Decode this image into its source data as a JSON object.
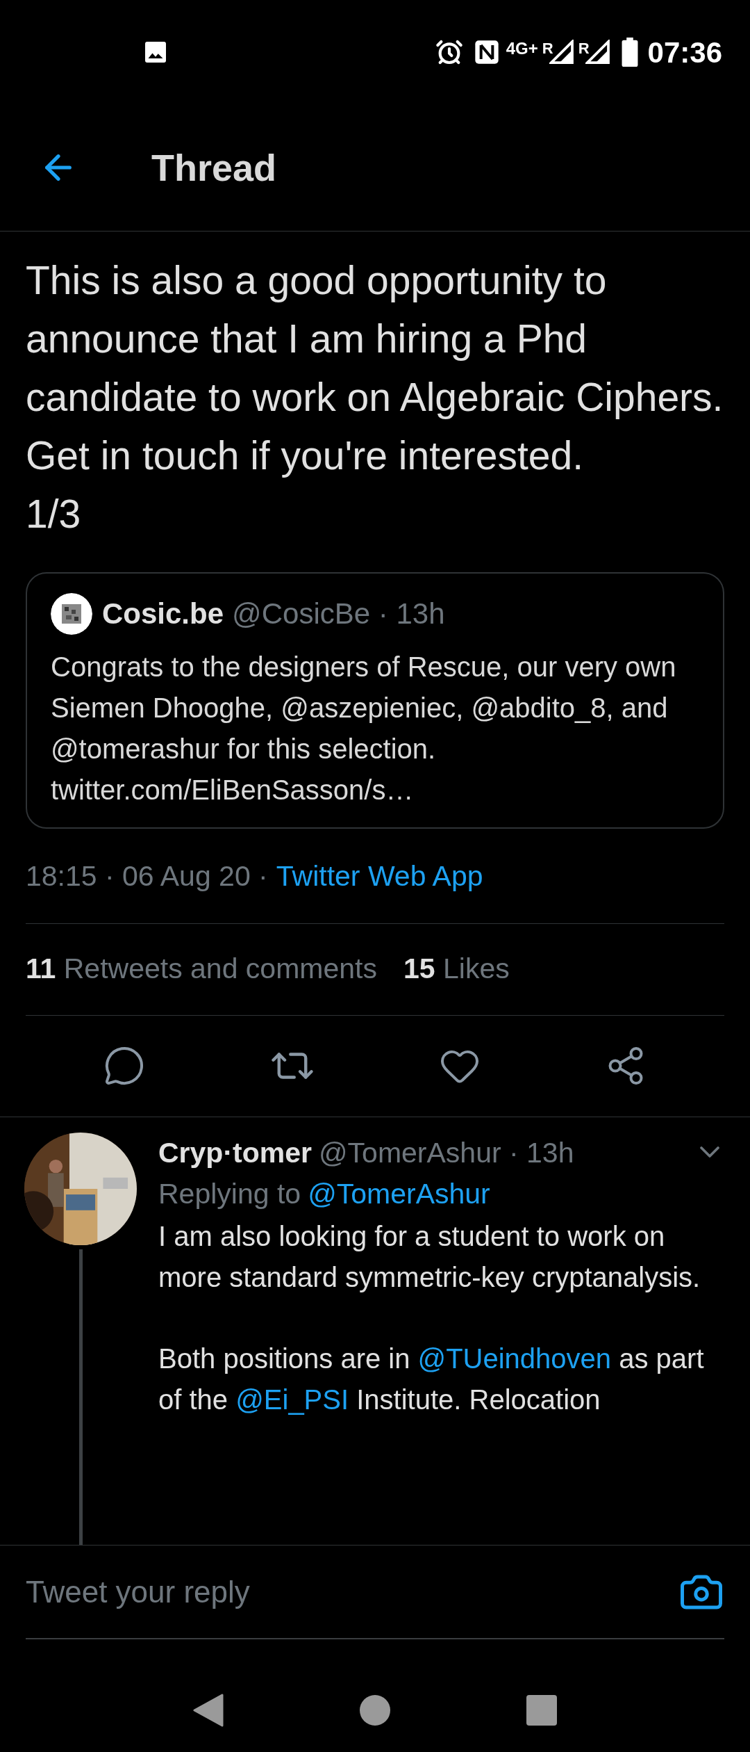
{
  "status_bar": {
    "network": "4G+",
    "roaming": [
      "R",
      "R"
    ],
    "time": "07:36"
  },
  "header": {
    "title": "Thread"
  },
  "tweet": {
    "text": "This is also a good opportunity to announce that I am hiring a Phd candidate to work on Algebraic Ciphers. Get in touch if you're interested.\n1/3",
    "quote": {
      "name": "Cosic.be",
      "meta": "@CosicBe · 13h",
      "text": "Congrats to the designers of Rescue, our very own Siemen Dhooghe, @aszepieniec, @abdito_8, and @tomerashur for this selection. twitter.com/EliBenSasson/s…"
    },
    "timestamp": "18:15 · 06 Aug 20 ·",
    "source": "Twitter Web App",
    "stats": [
      {
        "count": "11",
        "label": "Retweets and comments"
      },
      {
        "count": "15",
        "label": "Likes"
      }
    ]
  },
  "reply": {
    "name": "Cryp·tomer",
    "meta": "@TomerAshur · 13h",
    "replying_label": "Replying to",
    "replying_to": "@TomerAshur",
    "paragraphs": [
      [
        {
          "text": "I am also looking for a student to work on more standard symmetric-key cryptanalysis.",
          "kind": "text"
        }
      ],
      [
        {
          "text": "Both positions are in ",
          "kind": "text"
        },
        {
          "text": "@TUeindhoven",
          "kind": "link"
        },
        {
          "text": " as part of the ",
          "kind": "text"
        },
        {
          "text": "@Ei_PSI",
          "kind": "link"
        },
        {
          "text": " Institute. Relocation",
          "kind": "text"
        }
      ]
    ]
  },
  "composer": {
    "placeholder": "Tweet your reply"
  }
}
